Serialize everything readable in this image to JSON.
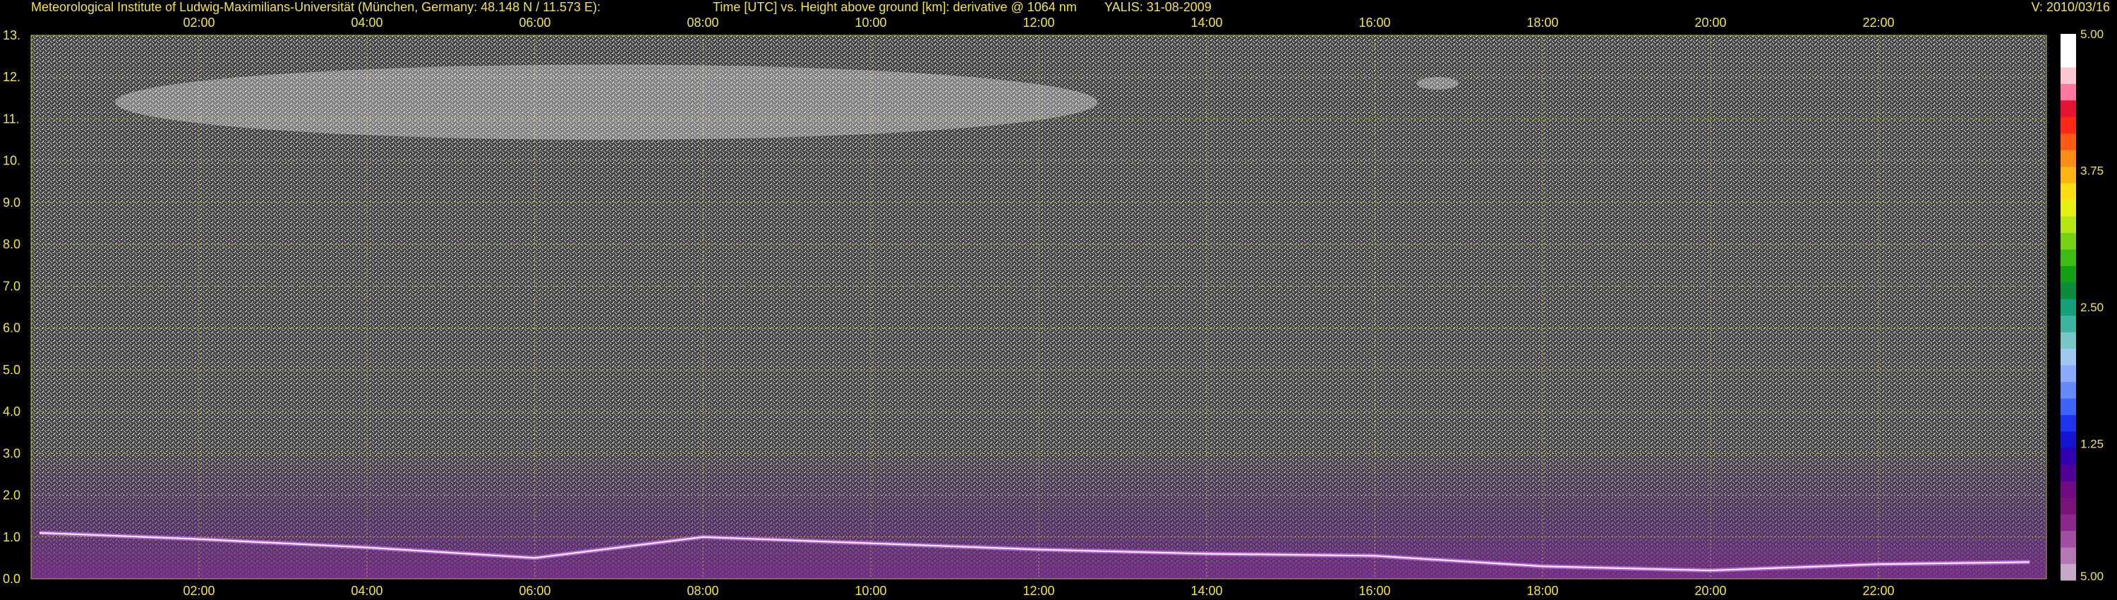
{
  "header": {
    "institute": "Meteorological Institute of Ludwig-Maximilians-Universität (München, Germany: 48.148 N / 11.573 E):",
    "title": "Time [UTC] vs. Height above ground [km]: derivative @ 1064 nm",
    "station_date": "YALIS: 31-08-2009",
    "version": "V: 2010/03/16"
  },
  "colors": {
    "background": "#000000",
    "text": "#f5e63a",
    "grid": "#b4b428"
  },
  "chart_data": {
    "type": "heatmap",
    "title": "Time [UTC] vs. Height above ground [km]: derivative @ 1064 nm",
    "xlabel": "Time [UTC]",
    "ylabel": "Height above ground [km]",
    "xlim": [
      0,
      24
    ],
    "ylim": [
      0,
      13
    ],
    "x_ticks": [
      2,
      4,
      6,
      8,
      10,
      12,
      14,
      16,
      18,
      20,
      22
    ],
    "x_tick_labels": [
      "02:00",
      "04:00",
      "06:00",
      "08:00",
      "10:00",
      "12:00",
      "14:00",
      "16:00",
      "18:00",
      "20:00",
      "22:00"
    ],
    "y_ticks": [
      0,
      1,
      2,
      3,
      4,
      5,
      6,
      7,
      8,
      9,
      10,
      11,
      12,
      13
    ],
    "y_tick_labels": [
      "0.0",
      "1.0",
      "2.0",
      "3.0",
      "4.0",
      "5.0",
      "6.0",
      "7.0",
      "8.0",
      "9.0",
      "10.",
      "11.",
      "12.",
      "13."
    ],
    "grid": true,
    "colorbar": {
      "tick_labels": [
        "5.00",
        "1.25",
        "2.50",
        "3.75",
        "5.00"
      ],
      "colors": [
        "#c8a8c8",
        "#b478b4",
        "#a050a0",
        "#8c288c",
        "#781478",
        "#6e0a82",
        "#500096",
        "#3200b4",
        "#1414d2",
        "#1e32f0",
        "#3c64ff",
        "#648cff",
        "#8caaff",
        "#a0c8f0",
        "#78c8c8",
        "#3cb4a0",
        "#14a078",
        "#0a8c3c",
        "#14a014",
        "#3cbe14",
        "#78d214",
        "#b4e614",
        "#e6f014",
        "#ffdc14",
        "#ffb414",
        "#ff8c14",
        "#ff5a14",
        "#ff2814",
        "#e61432",
        "#ff78a0",
        "#ffc8d2",
        "#ffffff",
        "#ffffff"
      ]
    },
    "features": [
      {
        "name": "cirrus layer",
        "x_range": [
          1,
          12.7
        ],
        "y_range": [
          10.5,
          12.3
        ]
      },
      {
        "name": "cirrus patch",
        "x_range": [
          16.5,
          17.0
        ],
        "y_range": [
          11.7,
          12.0
        ]
      },
      {
        "name": "boundary layer top",
        "x": [
          0.1,
          2,
          4,
          6,
          8,
          10,
          12,
          14,
          16,
          18,
          20,
          22,
          23.8
        ],
        "y": [
          1.1,
          0.95,
          0.75,
          0.5,
          1.0,
          0.85,
          0.7,
          0.6,
          0.55,
          0.3,
          0.2,
          0.35,
          0.4
        ]
      }
    ]
  }
}
